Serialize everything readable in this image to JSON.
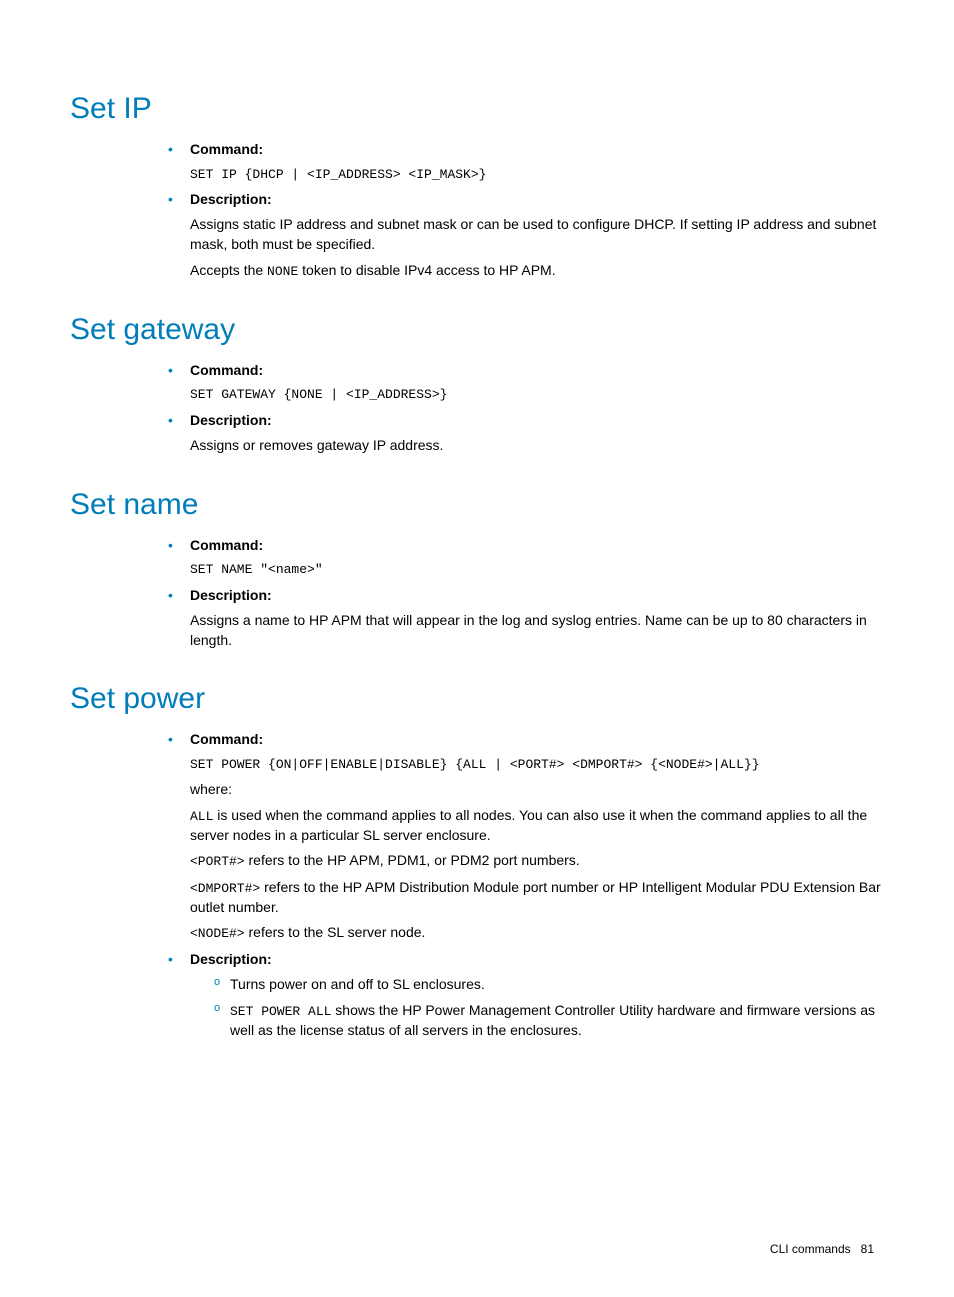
{
  "sections": [
    {
      "heading": "Set IP",
      "command_label": "Command:",
      "command_code": "SET IP {DHCP | <IP_ADDRESS> <IP_MASK>}",
      "description_label": "Description:",
      "description_paras": [
        "Assigns static IP address and subnet mask or can be used to configure DHCP. If setting IP address and subnet mask, both must be specified."
      ],
      "description_mixed": {
        "pre": "Accepts the ",
        "code": "NONE",
        "post": " token to disable IPv4 access to HP APM."
      }
    },
    {
      "heading": "Set gateway",
      "command_label": "Command:",
      "command_code": "SET GATEWAY {NONE | <IP_ADDRESS>}",
      "description_label": "Description:",
      "description_paras": [
        "Assigns or removes gateway IP address."
      ]
    },
    {
      "heading": "Set name",
      "command_label": "Command:",
      "command_code": "SET NAME \"<name>\"",
      "description_label": "Description:",
      "description_paras": [
        "Assigns a name to HP APM that will appear in the log and syslog entries. Name can be up to 80 characters in length."
      ]
    }
  ],
  "power": {
    "heading": "Set power",
    "command_label": "Command:",
    "command_code": "SET POWER {ON|OFF|ENABLE|DISABLE} {ALL | <PORT#> <DMPORT#> {<NODE#>|ALL}}",
    "where": "where:",
    "p_all_code": "ALL",
    "p_all_text": " is used when the command applies to all nodes. You can also use it when the command applies to all the server nodes in a particular SL server enclosure.",
    "p_port_code": "<PORT#>",
    "p_port_text": " refers to the HP APM, PDM1, or PDM2 port numbers.",
    "p_dmport_code": "<DMPORT#>",
    "p_dmport_text": " refers to the HP APM Distribution Module port number or HP Intelligent Modular PDU Extension Bar outlet number.",
    "p_node_code": "<NODE#>",
    "p_node_text": " refers to the SL server node.",
    "description_label": "Description:",
    "sub1": "Turns power on and off to SL enclosures.",
    "sub2_code": "SET POWER ALL",
    "sub2_text": " shows the HP Power Management Controller Utility hardware and firmware versions as well as the license status of all servers in the enclosures."
  },
  "footer": {
    "text": "CLI commands",
    "page": "81"
  }
}
